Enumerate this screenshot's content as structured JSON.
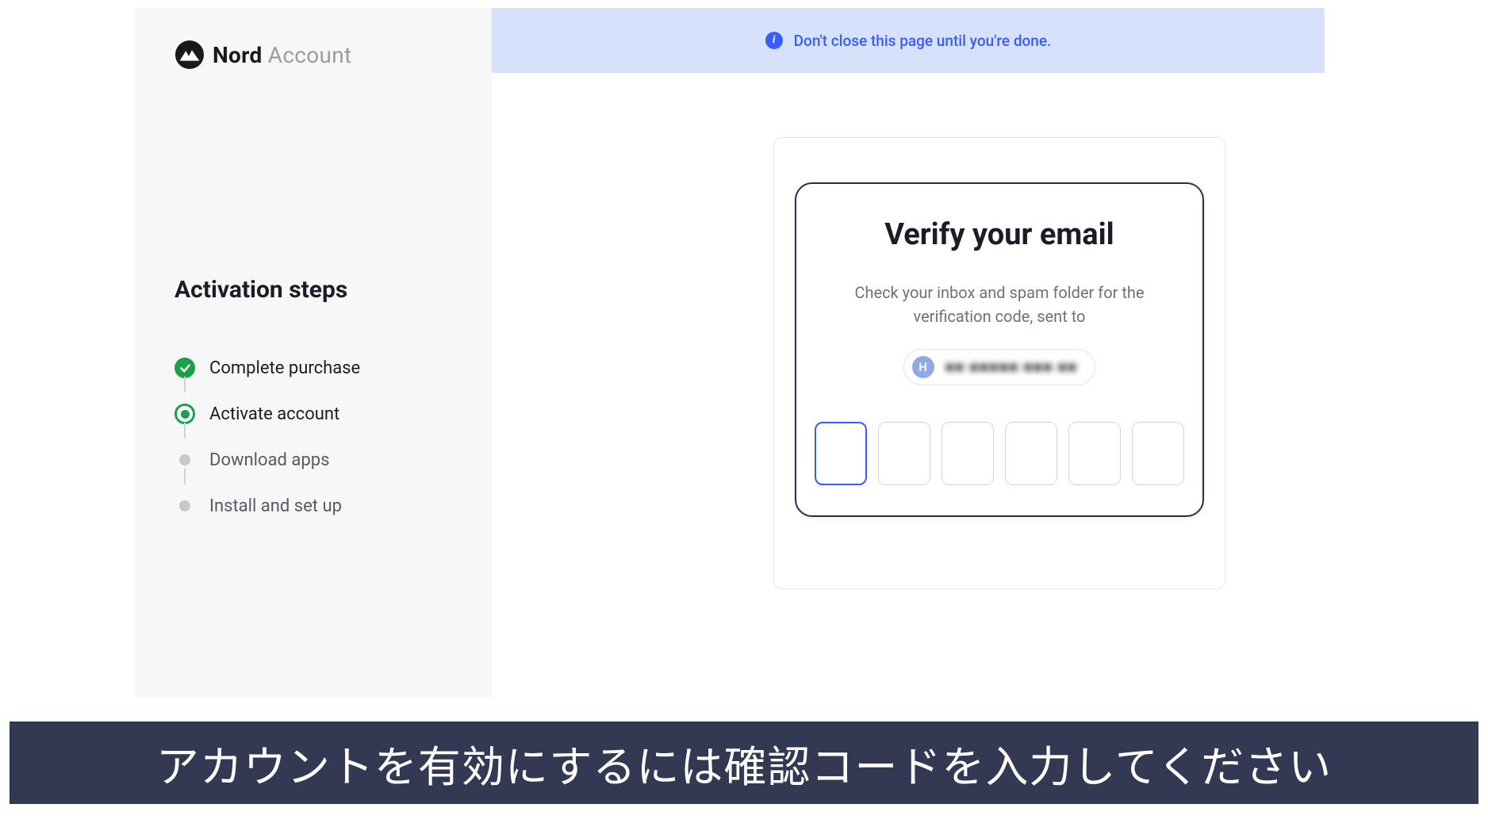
{
  "brand": {
    "name_bold": "Nord",
    "name_light": "Account"
  },
  "sidebar": {
    "title": "Activation steps",
    "steps": [
      {
        "label": "Complete purchase",
        "state": "done"
      },
      {
        "label": "Activate account",
        "state": "active"
      },
      {
        "label": "Download apps",
        "state": "pending"
      },
      {
        "label": "Install and set up",
        "state": "pending"
      }
    ]
  },
  "banner": {
    "text": "Don't close this page until you're done."
  },
  "verify": {
    "title": "Verify your email",
    "subtitle": "Check your inbox and spam folder for the verification code, sent to",
    "avatar_initial": "H",
    "email_masked": "■■ ■■■■■  ■■■ ■■",
    "code_length": 6
  },
  "caption": {
    "text": "アカウントを有効にするには確認コードを入力してください"
  }
}
